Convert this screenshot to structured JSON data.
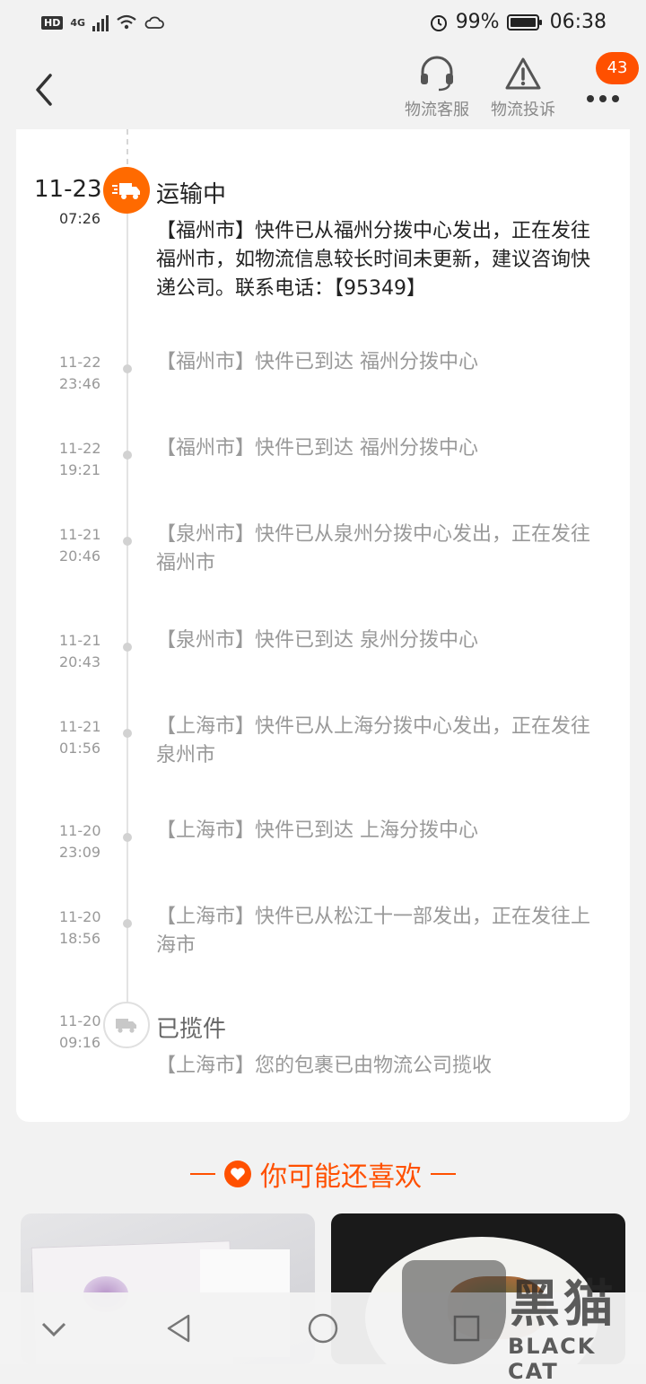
{
  "status_bar": {
    "hd": "HD",
    "network": "4G",
    "battery_percent": "99%",
    "battery_level": 0.99,
    "time": "06:38"
  },
  "header": {
    "back_icon": "chevron-left-icon",
    "actions": [
      {
        "label": "物流客服",
        "icon": "headset-icon"
      },
      {
        "label": "物流投诉",
        "icon": "warning-triangle-icon"
      }
    ],
    "more_icon": "more-dots-icon",
    "badge_count": "43"
  },
  "timeline": {
    "current": {
      "date": "11-23",
      "time": "07:26",
      "status": "运输中",
      "description": "【福州市】快件已从福州分拨中心发出，正在发往福州市，如物流信息较长时间未更新，建议咨询快递公司。联系电话：【95349】",
      "icon": "truck-icon",
      "accent": "#ff6a00"
    },
    "events": [
      {
        "date": "11-22",
        "time": "23:46",
        "text": "【福州市】快件已到达 福州分拨中心"
      },
      {
        "date": "11-22",
        "time": "19:21",
        "text": "【福州市】快件已到达 福州分拨中心"
      },
      {
        "date": "11-21",
        "time": "20:46",
        "text": "【泉州市】快件已从泉州分拨中心发出，正在发往福州市"
      },
      {
        "date": "11-21",
        "time": "20:43",
        "text": "【泉州市】快件已到达 泉州分拨中心"
      },
      {
        "date": "11-21",
        "time": "01:56",
        "text": "【上海市】快件已从上海分拨中心发出，正在发往泉州市"
      },
      {
        "date": "11-20",
        "time": "23:09",
        "text": "【上海市】快件已到达 上海分拨中心"
      },
      {
        "date": "11-20",
        "time": "18:56",
        "text": "【上海市】快件已从松江十一部发出，正在发往上海市"
      }
    ],
    "start": {
      "date": "11-20",
      "time": "09:16",
      "status": "已揽件",
      "description": "【上海市】您的包裹已由物流公司揽收",
      "icon": "truck-outline-icon"
    }
  },
  "recommend": {
    "title": "你可能还喜欢",
    "icon": "heart-icon",
    "accent": "#ff5000"
  },
  "watermark": {
    "cn": "黑猫",
    "en": "BLACK CAT"
  },
  "nav_bar": {
    "icons": [
      "chevron-down-icon",
      "back-triangle-icon",
      "home-circle-icon",
      "recents-square-icon"
    ]
  }
}
